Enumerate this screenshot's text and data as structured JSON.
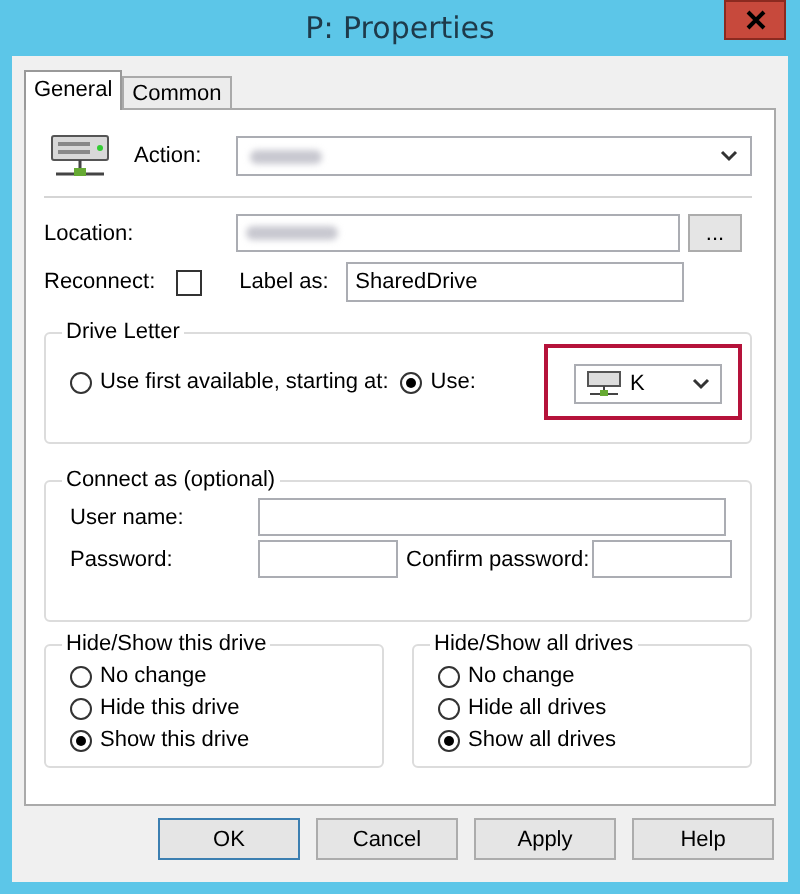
{
  "window": {
    "title": "P: Properties"
  },
  "tabs": [
    {
      "label": "General",
      "selected": true
    },
    {
      "label": "Common",
      "selected": false
    }
  ],
  "action": {
    "label": "Action:"
  },
  "location": {
    "label": "Location:",
    "browse": "..."
  },
  "reconnect": {
    "label": "Reconnect:",
    "checked": false
  },
  "label_as": {
    "label": "Label as:",
    "value": "SharedDrive"
  },
  "drive_letter": {
    "title": "Drive Letter",
    "options": [
      {
        "label": "Use first available, starting at:",
        "selected": false
      },
      {
        "label": "Use:",
        "selected": true
      }
    ],
    "letter": "K",
    "highlighted": true
  },
  "connect_as": {
    "title": "Connect as (optional)",
    "user_label": "User name:",
    "password_label": "Password:",
    "confirm_label": "Confirm password:"
  },
  "hide_show_groups": [
    {
      "title": "Hide/Show this drive",
      "options": [
        {
          "label": "No change",
          "selected": false
        },
        {
          "label": "Hide this drive",
          "selected": false
        },
        {
          "label": "Show this drive",
          "selected": true
        }
      ]
    },
    {
      "title": "Hide/Show all drives",
      "options": [
        {
          "label": "No change",
          "selected": false
        },
        {
          "label": "Hide all drives",
          "selected": false
        },
        {
          "label": "Show all drives",
          "selected": true
        }
      ]
    }
  ],
  "buttons": [
    {
      "label": "OK",
      "default": true
    },
    {
      "label": "Cancel",
      "default": false
    },
    {
      "label": "Apply",
      "default": false
    },
    {
      "label": "Help",
      "default": false
    }
  ]
}
